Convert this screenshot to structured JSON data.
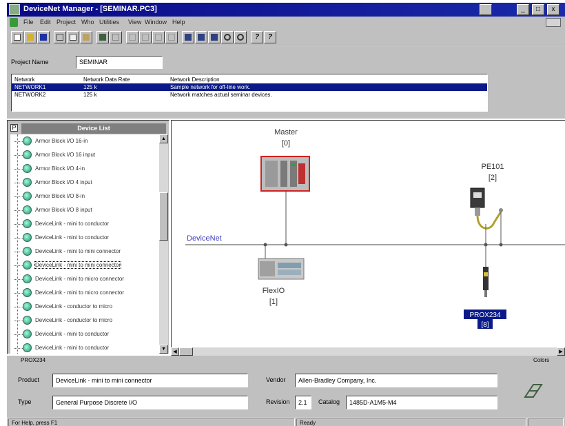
{
  "window": {
    "title": "DeviceNet Manager - [SEMINAR.PC3]",
    "controls": [
      "_",
      "□",
      "x"
    ]
  },
  "menu": [
    "File",
    "Edit",
    "Project",
    "Who",
    "Utilities",
    "View",
    "Window",
    "Help"
  ],
  "toolbar": {
    "buttons": [
      "new",
      "open",
      "save",
      "cut",
      "copy",
      "paste",
      "find",
      "undo",
      "redo",
      "align",
      "group",
      "ungroup",
      "help",
      "view-network",
      "view-devices",
      "view-table",
      "zoom-in",
      "zoom-out",
      "about",
      "context-help"
    ]
  },
  "project": {
    "name_label": "Project Name",
    "name_value": "SEMINAR",
    "networks_headers": [
      "Network",
      "Network Data Rate",
      "Network Description"
    ],
    "networks": [
      {
        "name": "NETWORK1",
        "rate": "125 k",
        "description": "Sample network for off-line work.",
        "selected": true
      },
      {
        "name": "NETWORK2",
        "rate": "125 k",
        "description": "Network matches actual seminar devices.",
        "selected": false
      }
    ]
  },
  "device_list": {
    "header": "Device List",
    "checkbox": "P",
    "items": [
      "Armor Block I/O 16-in",
      "Armor Block I/O 16 input",
      "Armor Block I/O 4-in",
      "Armor Block I/O 4 input",
      "Armor Block I/O 8-in",
      "Armor Block I/O 8 input",
      "DeviceLink - mini to conductor",
      "DeviceLink - mini to conductor",
      "DeviceLink - mini to mini connector",
      "DeviceLink - mini to mini connector",
      "DeviceLink - mini to micro connector",
      "DeviceLink - mini to micro connector",
      "DeviceLink - conductor to micro",
      "DeviceLink - conductor to micro",
      "DeviceLink - mini to conductor",
      "DeviceLink - mini to conductor"
    ],
    "selected_index": 9
  },
  "network_view": {
    "trunk_label": "DeviceNet",
    "nodes": [
      {
        "name": "Master",
        "address": "[0]"
      },
      {
        "name": "PE101",
        "address": "[2]"
      },
      {
        "name": "FlexIO",
        "address": "[1]"
      },
      {
        "name": "PROX234",
        "address": "[8]"
      }
    ]
  },
  "details": {
    "node_name": "PROX234",
    "product_label": "Product",
    "product_value": "DeviceLink - mini to mini connector",
    "type_label": "Type",
    "type_value": "General Purpose Discrete I/O",
    "vendor_label": "Vendor",
    "vendor_value": "Allen-Bradley Company, Inc.",
    "revision_label": "Revision",
    "revision_value": "2.1",
    "catalog_label": "Catalog",
    "catalog_value": "1485D-A1M5-M4",
    "colors_label": "Colors"
  },
  "status": {
    "help_text": "For Help, press F1",
    "state": "Ready"
  },
  "colors": {
    "titlebar": "#0a0a88",
    "selection": "#0a1a88",
    "master_outline": "#d02020",
    "trunk": "#4040c0",
    "device_icon": "#2a8a6a"
  }
}
